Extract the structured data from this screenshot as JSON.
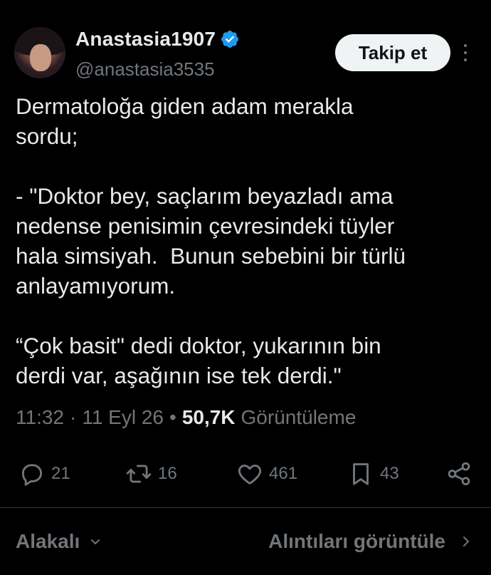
{
  "author": {
    "display_name": "Anastasia1907",
    "handle": "@anastasia3535",
    "verified_color": "#1d9bf0"
  },
  "follow_label": "Takip et",
  "tweet": {
    "text": "Dermatoloğa giden adam merakla\nsordu;\n\n- \"Doktor bey, saçlarım beyazladı ama\nnedense penisimin çevresindeki tüyler\nhala simsiyah.  Bunun sebebini bir türlü\nanlayamıyorum.\n\n“Çok basit\" dedi doktor, yukarının bin\nderdi var, aşağının ise tek derdi.\""
  },
  "meta": {
    "time": "11:32",
    "separator": "·",
    "date": "11 Eyl 26",
    "bullet": "•",
    "views_count": "50,7K",
    "views_label": "Görüntüleme"
  },
  "actions": {
    "replies": "21",
    "reposts": "16",
    "likes": "461",
    "bookmarks": "43"
  },
  "bottom": {
    "sort_label": "Alakalı",
    "quotes_label": "Alıntıları görüntüle"
  },
  "icons": {
    "reply": "reply-icon",
    "repost": "repost-icon",
    "like": "heart-icon",
    "bookmark": "bookmark-icon",
    "share": "share-icon",
    "more": "more-icon",
    "verified": "verified-badge-icon"
  }
}
